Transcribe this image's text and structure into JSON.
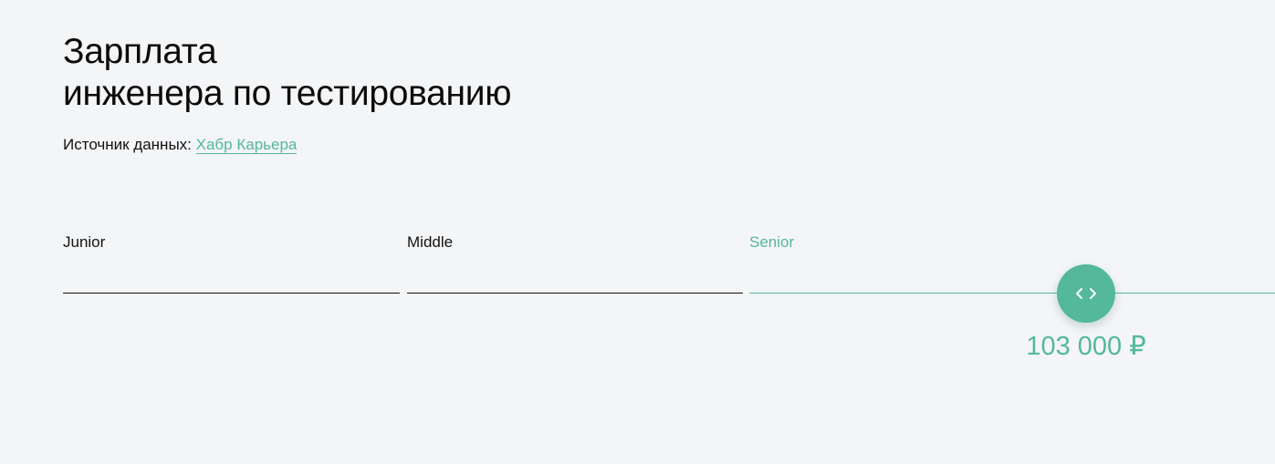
{
  "header": {
    "title_line1": "Зарплата",
    "title_line2": "инженера по тестированию"
  },
  "source": {
    "label": "Источник данных:",
    "link_text": "Хабр Карьера"
  },
  "levels": [
    {
      "label": "Junior",
      "active": false
    },
    {
      "label": "Middle",
      "active": false
    },
    {
      "label": "Senior",
      "active": true
    }
  ],
  "slider": {
    "icon": "chevrons-left-right-icon",
    "value": "103 000 ₽"
  },
  "colors": {
    "accent": "#54b89a",
    "background": "#f4f5f7",
    "text": "#111111"
  }
}
